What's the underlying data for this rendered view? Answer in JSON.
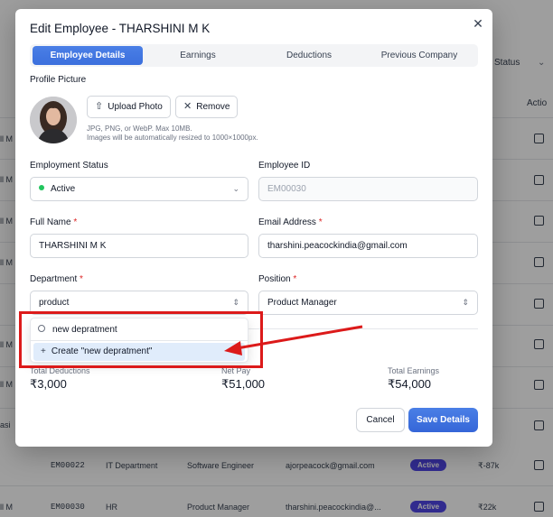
{
  "background": {
    "header_status": "Status",
    "header_actions": "Actio",
    "left_cells": [
      "ll M",
      "ll M",
      "ll M",
      "ll M",
      "ll M",
      "ll M",
      "asi",
      "ll M"
    ],
    "rows": [
      {
        "id": "EM00022",
        "dept": "IT Department",
        "role": "Software Engineer",
        "email": "ajorpeacock@gmail.com",
        "status": "Active",
        "pay": "₹-87k"
      },
      {
        "id": "EM00030",
        "dept": "HR",
        "role": "Product Manager",
        "email": "tharshini.peacockindia@...",
        "status": "Active",
        "pay": "₹22k"
      }
    ],
    "right_cells": [
      "y",
      "k",
      "k",
      "k",
      "k",
      "k",
      "k",
      "k"
    ]
  },
  "modal": {
    "title": "Edit Employee - THARSHINI M K",
    "close_icon": "close-icon",
    "tabs": [
      {
        "label": "Employee Details",
        "active": true
      },
      {
        "label": "Earnings",
        "active": false
      },
      {
        "label": "Deductions",
        "active": false
      },
      {
        "label": "Previous Company",
        "active": false
      }
    ],
    "profile_picture_label": "Profile Picture",
    "upload_label": "Upload Photo",
    "remove_label": "Remove",
    "hint_line1": "JPG, PNG, or WebP. Max 10MB.",
    "hint_line2": "Images will be automatically resized to 1000×1000px.",
    "employment_status_label": "Employment Status",
    "employment_status_value": "Active",
    "employee_id_label": "Employee ID",
    "employee_id_value": "EM00030",
    "full_name_label": "Full Name",
    "full_name_value": "THARSHINI M K",
    "email_label": "Email Address",
    "email_value": "tharshini.peacockindia@gmail.com",
    "department_label": "Department",
    "department_value": "product",
    "position_label": "Position",
    "position_value": "Product Manager",
    "required_mark": "*",
    "dropdown": {
      "search_value": "new depratment",
      "create_option": "Create \"new depratment\""
    },
    "total_deductions_label": "Total Deductions",
    "total_deductions_value": "₹3,000",
    "net_pay_label": "Net Pay",
    "net_pay_value": "₹51,000",
    "total_earnings_label": "Total Earnings",
    "total_earnings_value": "₹54,000",
    "cancel_label": "Cancel",
    "save_label": "Save Details"
  },
  "colors": {
    "primary": "#3b6fdd",
    "annotation": "#dc1a1a",
    "active_dot": "#22c55e",
    "option_highlight": "#e0ecfb"
  }
}
